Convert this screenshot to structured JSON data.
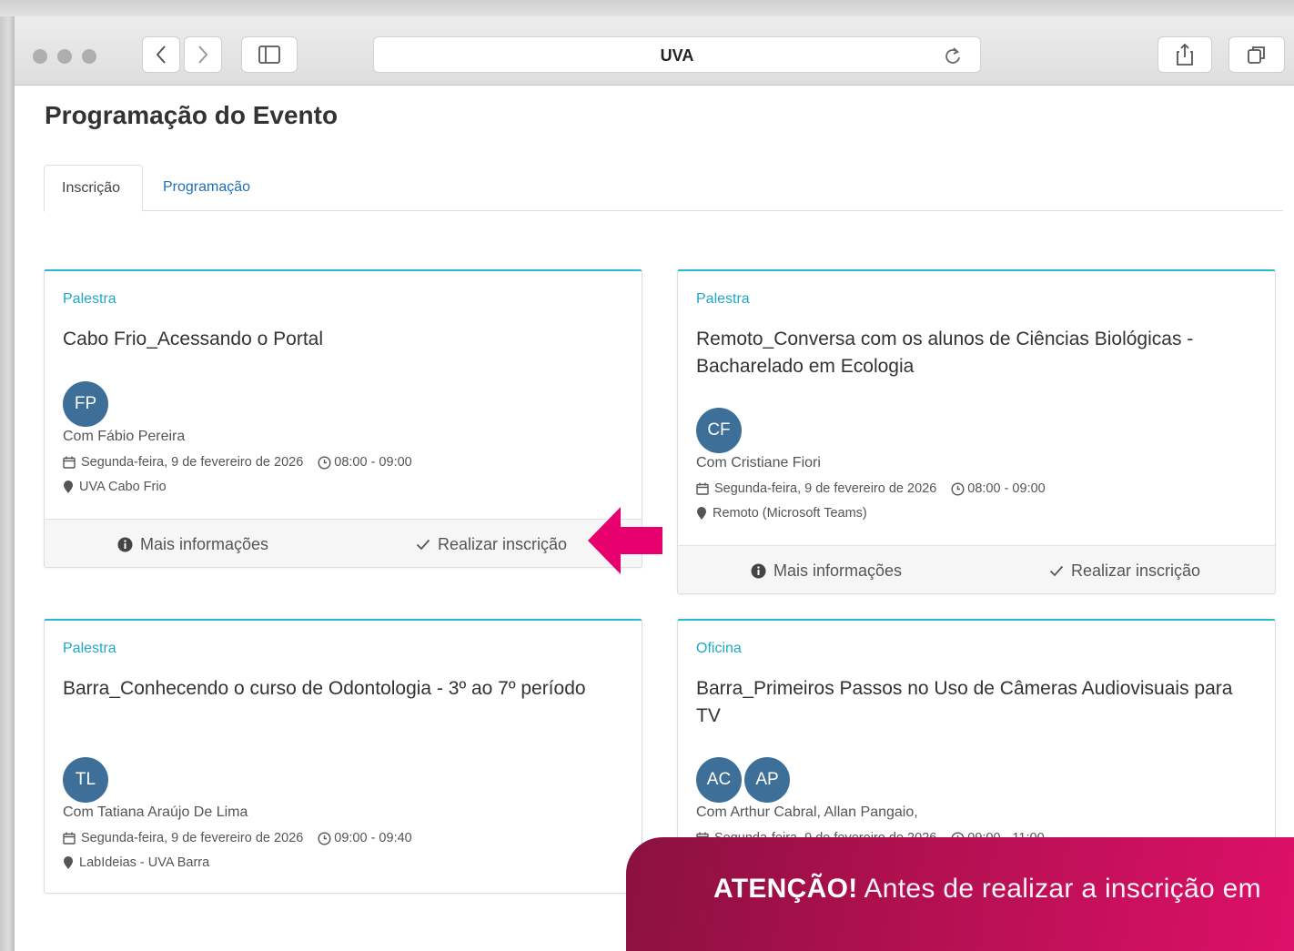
{
  "browser": {
    "url_title": "UVA"
  },
  "page": {
    "title": "Programação do Evento",
    "tabs": [
      {
        "label": "Inscrição"
      },
      {
        "label": "Programação"
      }
    ]
  },
  "cards": [
    {
      "type": "Palestra",
      "title": "Cabo Frio_Acessando o Portal",
      "avatars": [
        "FP"
      ],
      "speakers": "Com Fábio Pereira",
      "date": "Segunda-feira, 9 de fevereiro de 2026",
      "time": "08:00 - 09:00",
      "location": "UVA Cabo Frio",
      "more_info": "Mais informações",
      "register": "Realizar inscrição"
    },
    {
      "type": "Palestra",
      "title": "Remoto_Conversa com os alunos de Ciências Biológicas - Bacharelado em Ecologia",
      "avatars": [
        "CF"
      ],
      "speakers": "Com Cristiane Fiori",
      "date": "Segunda-feira, 9 de fevereiro de 2026",
      "time": "08:00 - 09:00",
      "location": "Remoto (Microsoft Teams)",
      "more_info": "Mais informações",
      "register": "Realizar inscrição"
    },
    {
      "type": "Palestra",
      "title": "Barra_Conhecendo o curso de Odontologia - 3º ao 7º período",
      "avatars": [
        "TL"
      ],
      "speakers": "Com Tatiana Araújo De Lima",
      "date": "Segunda-feira, 9 de fevereiro de 2026",
      "time": "09:00 - 09:40",
      "location": "LabIdeias - UVA Barra"
    },
    {
      "type": "Oficina",
      "title": "Barra_Primeiros Passos no Uso de Câmeras Audiovisuais para TV",
      "avatars": [
        "AC",
        "AP"
      ],
      "speakers": "Com Arthur Cabral, Allan Pangaio,",
      "date": "Segunda-feira, 9 de fevereiro de 2026",
      "time": "09:00 - 11:00"
    }
  ],
  "attention": {
    "bold": "ATENÇÃO!",
    "text": " Antes de realizar a inscrição em"
  },
  "colors": {
    "accent": "#2ab8cf",
    "link": "#1f6fb2",
    "avatar": "#3d6f99",
    "highlight_arrow": "#e6006e"
  }
}
